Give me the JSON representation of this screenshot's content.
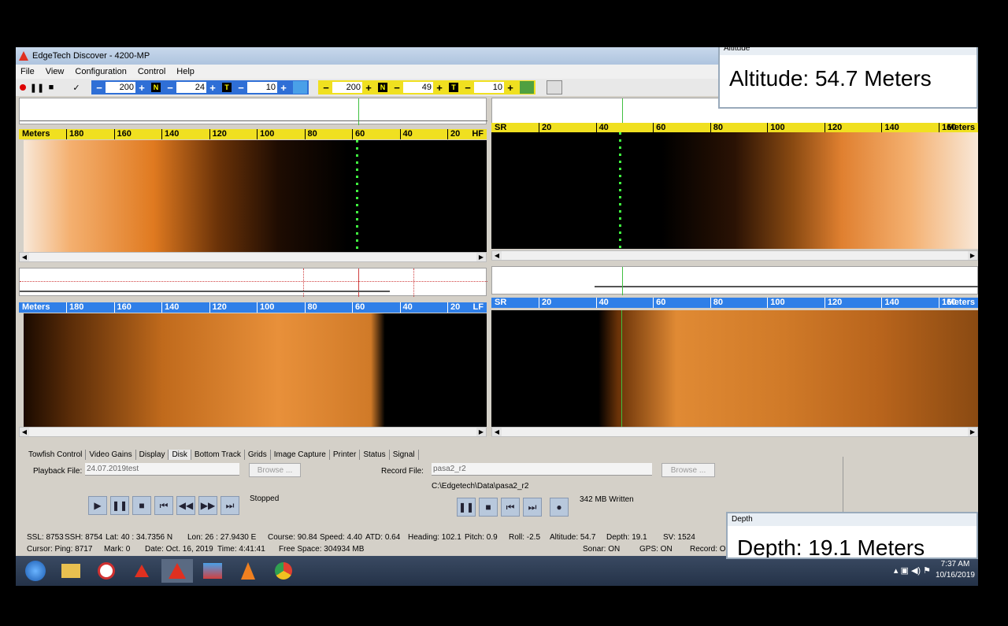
{
  "window": {
    "title": "EdgeTech  Discover - 4200-MP"
  },
  "menu": [
    "File",
    "View",
    "Configuration",
    "Control",
    "Help"
  ],
  "toolbar": {
    "hf": {
      "range": "200",
      "n": "24",
      "t": "10",
      "n_label": "N",
      "t_label": "T"
    },
    "lf": {
      "range": "200",
      "n": "49",
      "t": "10",
      "n_label": "N",
      "t_label": "T"
    },
    "check_icon": "✓",
    "minus": "−",
    "plus": "+"
  },
  "rulers": {
    "hf_port": {
      "start": "Meters",
      "ticks": [
        "180",
        "160",
        "140",
        "120",
        "100",
        "80",
        "60",
        "40",
        "20"
      ],
      "end": "HF"
    },
    "hf_stbd": {
      "start": "SR",
      "ticks": [
        "20",
        "40",
        "60",
        "80",
        "100",
        "120",
        "140",
        "160"
      ],
      "end": "Meters"
    },
    "lf_port": {
      "start": "Meters",
      "ticks": [
        "180",
        "160",
        "140",
        "120",
        "100",
        "80",
        "60",
        "40",
        "20"
      ],
      "end": "LF"
    },
    "lf_stbd": {
      "start": "SR",
      "ticks": [
        "20",
        "40",
        "60",
        "80",
        "100",
        "120",
        "140",
        "160"
      ],
      "end": "Meters"
    }
  },
  "tabs": [
    "Towfish Control",
    "Video Gains",
    "Display",
    "Disk",
    "Bottom Track",
    "Grids",
    "Image Capture",
    "Printer",
    "Status",
    "Signal"
  ],
  "active_tab": "Disk",
  "playback": {
    "label": "Playback File:",
    "value": "24.07.2019test",
    "browse": "Browse ...",
    "state": "Stopped"
  },
  "record": {
    "label": "Record File:",
    "value": "pasa2_r2",
    "browse": "Browse ...",
    "path": "C:\\Edgetech\\Data\\pasa2_r2",
    "written": "342 MB Written"
  },
  "status_line1": {
    "ssl": "SSL: 8753",
    "ssh": "SSH: 8754",
    "lat": "Lat:  40 : 34.7356 N",
    "lon": "Lon:  26 : 27.9430 E",
    "course": "Course: 90.84",
    "speed": "Speed:  4.40",
    "atd": "ATD:  0.64",
    "heading": "Heading: 102.1",
    "pitch": "Pitch:   0.9",
    "roll": "Roll:   -2.5",
    "altitude": "Altitude:   54.7",
    "depth": "Depth:    19.1",
    "sv": "SV:  1524"
  },
  "status_line2": {
    "cursor": "Cursor:  Ping:    8717",
    "mark": "Mark:    0",
    "date": "Date: Oct. 16, 2019",
    "time": "Time:  4:41:41",
    "free": "Free Space: 304934 MB",
    "sonar": "Sonar: ON",
    "gps": "GPS: ON",
    "record": "Record: O"
  },
  "altitude_popup": {
    "title": "Altitude",
    "value": "Altitude:   54.7 Meters"
  },
  "depth_popup": {
    "title": "Depth",
    "value": "Depth:   19.1 Meters"
  },
  "clock": {
    "time": "7:37 AM",
    "date": "10/16/2019"
  },
  "colors": {
    "sonar_bright": "#f08a30",
    "sonar_dark": "#1a0a00",
    "ruler_hf": "#f0e020",
    "ruler_lf": "#2f7fe8",
    "trace_green": "#40ff40"
  }
}
